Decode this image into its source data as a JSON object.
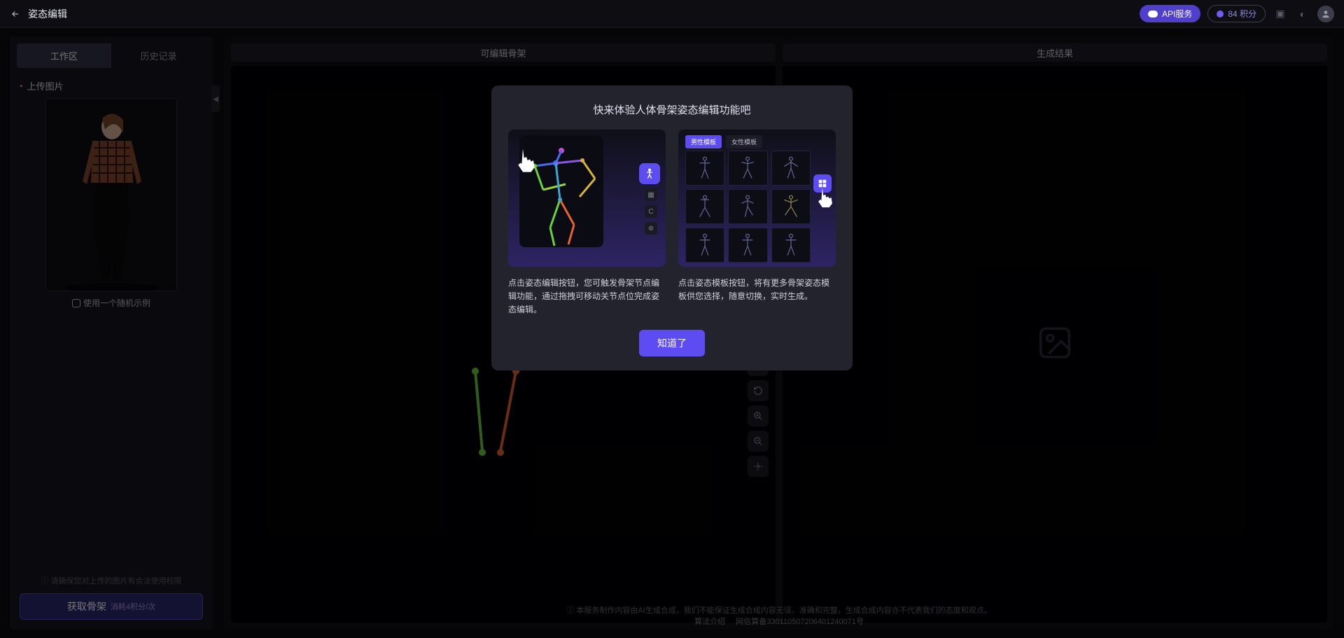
{
  "header": {
    "page_title": "姿态编辑",
    "api_button": "API服务",
    "points": "84 积分"
  },
  "left": {
    "tab_workspace": "工作区",
    "tab_history": "历史记录",
    "upload_label": "上传图片",
    "random_example": "使用一个随机示例",
    "legal_hint": "请确保您对上传的图片有合法使用权限",
    "get_skeleton": "获取骨架",
    "get_skeleton_cost": "消耗4积分/次"
  },
  "center": {
    "canvas_title": "可编辑骨架"
  },
  "right": {
    "canvas_title": "生成结果"
  },
  "modal": {
    "title": "快来体验人体骨架姿态编辑功能吧",
    "desc_edit": "点击姿态编辑按钮，您可触发骨架节点编辑功能，通过拖拽可移动关节点位完成姿态编辑。",
    "desc_template": "点击姿态模板按钮，将有更多骨架姿态模板供您选择，随意切换，实时生成。",
    "template_tab_male": "男性模板",
    "template_tab_female": "女性模板",
    "confirm": "知道了"
  },
  "footer": {
    "disclaimer": "本服务制作内容由AI生成合成，我们不能保证生成合成内容无误、准确和完整，生成合成内容亦不代表我们的态度和观点。",
    "algo_link": "算法介绍",
    "record": "网信算备330110507206401240071号"
  }
}
